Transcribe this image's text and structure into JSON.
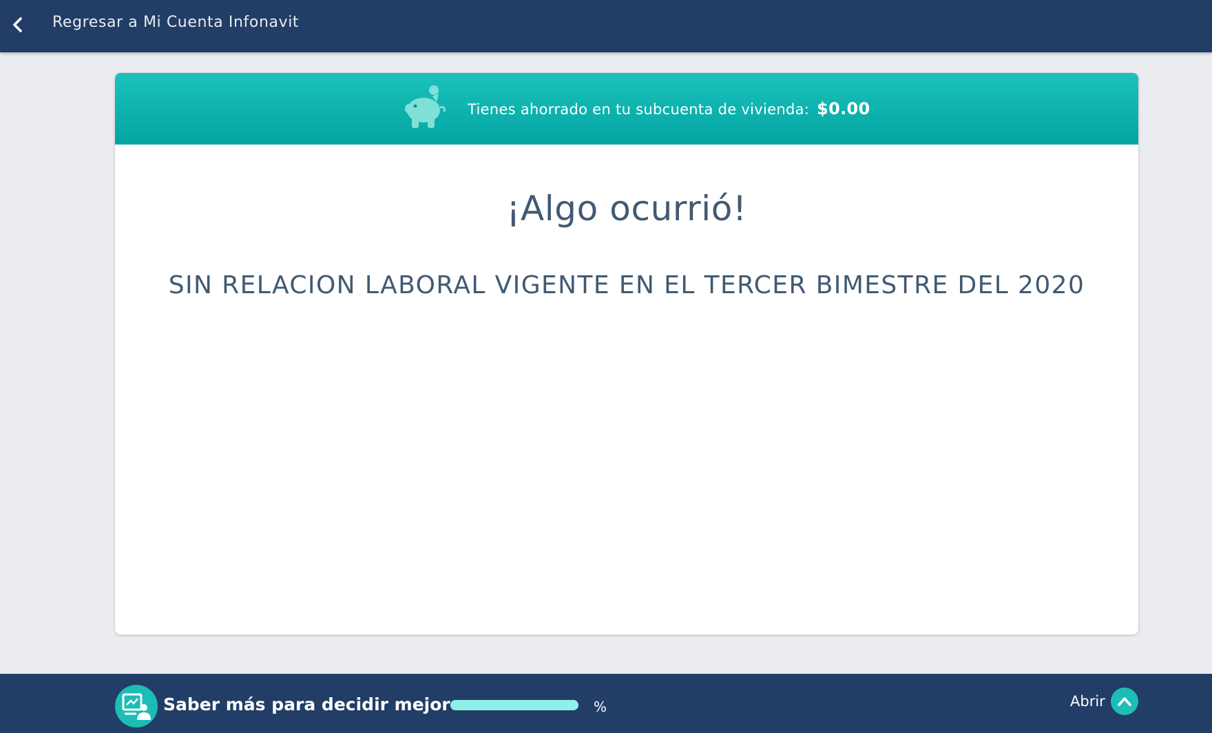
{
  "header": {
    "back_label": "Regresar a Mi Cuenta Infonavit",
    "back_icon": "chevron-left-icon"
  },
  "banner": {
    "icon": "piggy-bank-icon",
    "text": "Tienes ahorrado en tu subcuenta de vivienda:",
    "amount": "$0.00"
  },
  "main": {
    "title": "¡Algo ocurrió!",
    "message": "SIN RELACION LABORAL VIGENTE EN EL TERCER BIMESTRE DEL 2020"
  },
  "footer": {
    "icon": "presentation-icon",
    "title": "Saber más para decidir mejor",
    "percent_symbol": "%",
    "progress": 1.0,
    "open_label": "Abrir",
    "open_icon": "chevron-up-icon"
  },
  "colors": {
    "navy": "#223d66",
    "teal": "#1dbdb5",
    "text": "#415a73"
  }
}
